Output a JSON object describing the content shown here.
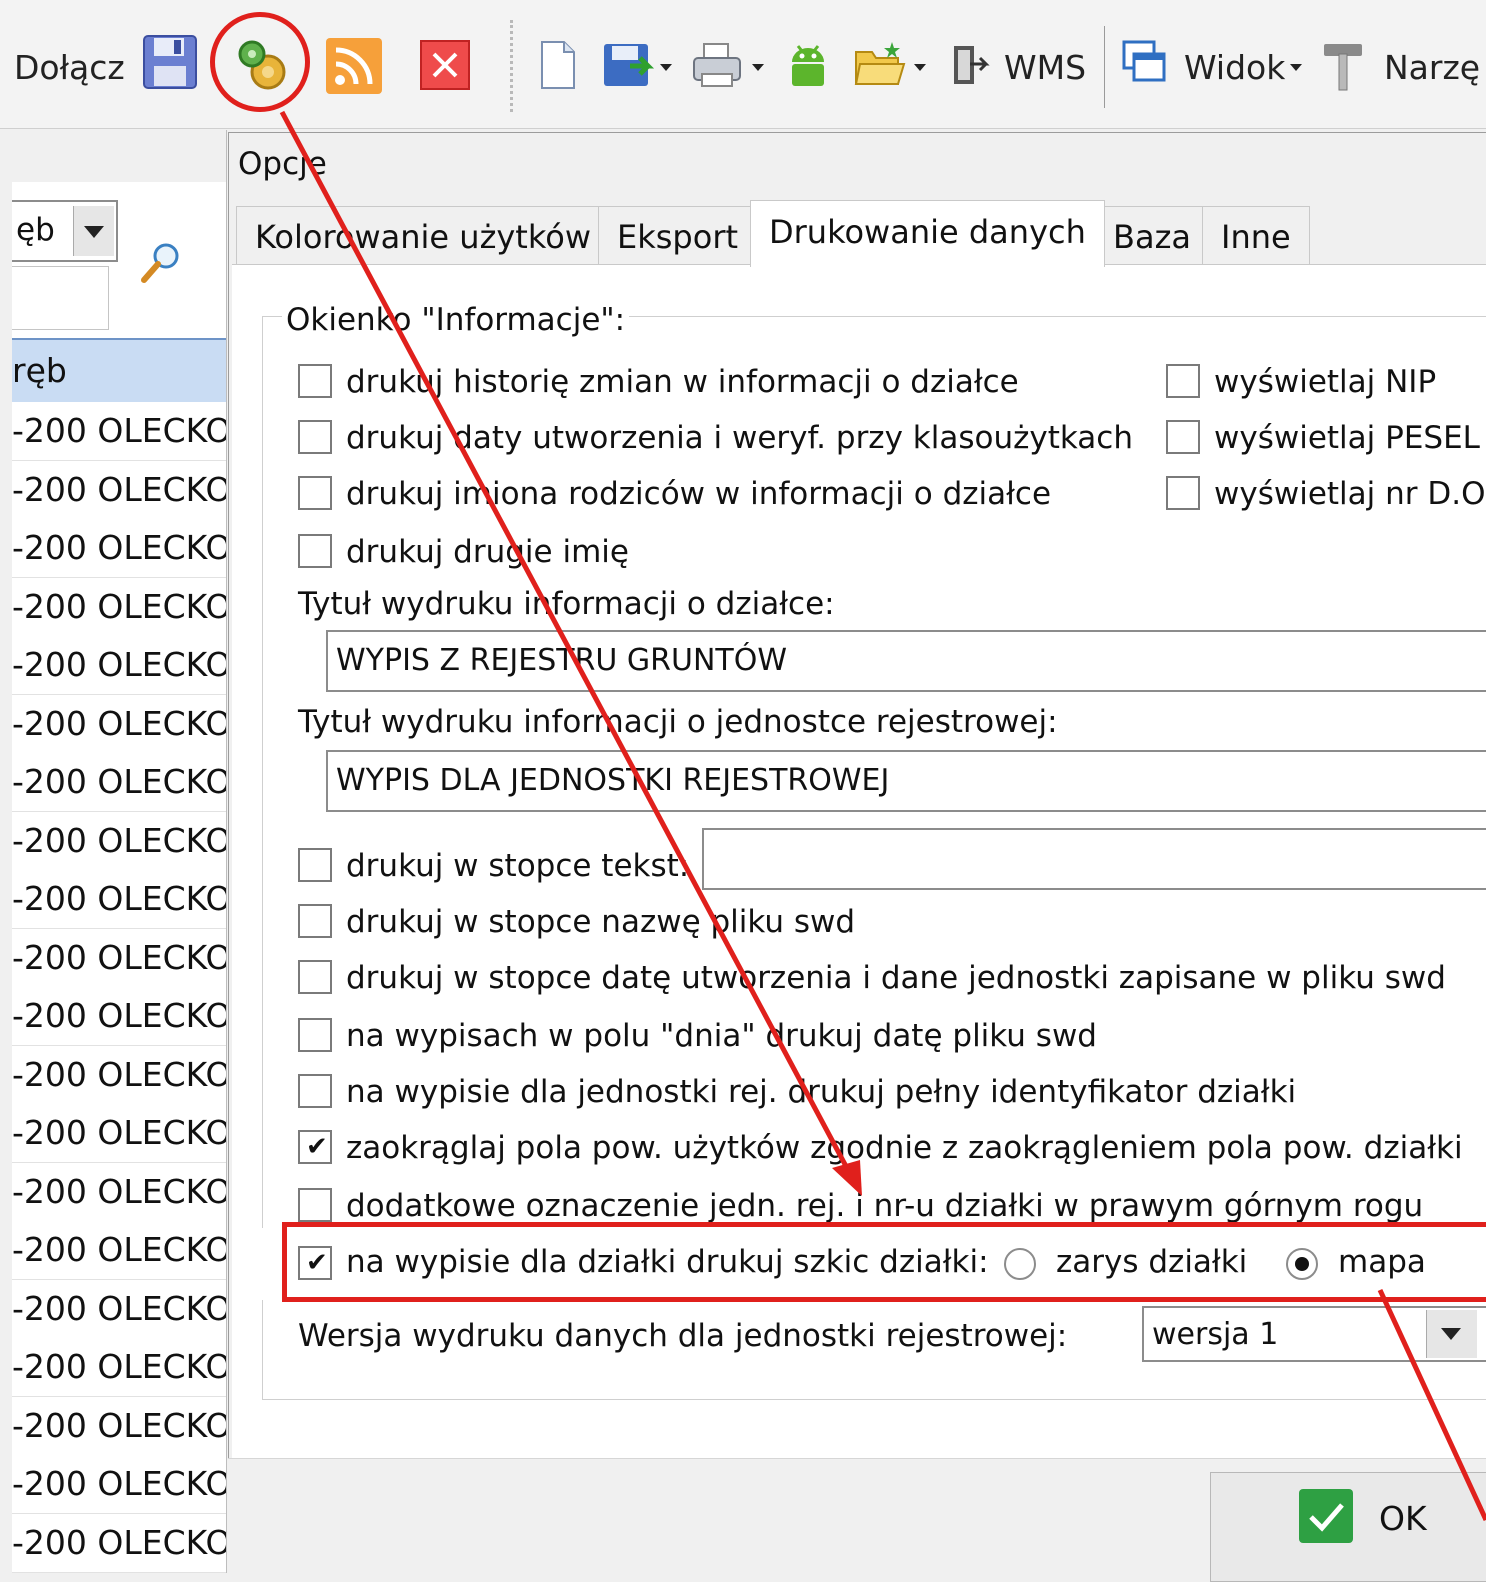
{
  "toolbar": {
    "join_label": "Dołącz",
    "wms_label": "WMS",
    "view_label": "Widok",
    "tools_label": "Narzę"
  },
  "left_panel": {
    "combo_value": "ęb",
    "column_header": "ręb",
    "rows": [
      "-200 OLECKO",
      "-200 OLECKO",
      "-200 OLECKO",
      "-200 OLECKO",
      "-200 OLECKO",
      "-200 OLECKO",
      "-200 OLECKO",
      "-200 OLECKO",
      "-200 OLECKO",
      "-200 OLECKO",
      "-200 OLECKO",
      "-200 OLECKO",
      "-200 OLECKO",
      "-200 OLECKO",
      "-200 OLECKO",
      "-200 OLECKO",
      "-200 OLECKO",
      "-200 OLECKO",
      "-200 OLECKO",
      "-200 OLECKO"
    ]
  },
  "dialog": {
    "title": "Opcje",
    "tabs": [
      {
        "label": "Kolorowanie użytków",
        "active": false
      },
      {
        "label": "Eksport",
        "active": false
      },
      {
        "label": "Drukowanie danych",
        "active": true
      },
      {
        "label": "Baza",
        "active": false
      },
      {
        "label": "Inne",
        "active": false
      }
    ],
    "group_title": "Okienko \"Informacje\":",
    "options_left": [
      {
        "label": "drukuj historię zmian w informacji o działce",
        "checked": false
      },
      {
        "label": "drukuj daty utworzenia i weryf. przy klasoużytkach",
        "checked": false
      },
      {
        "label": "drukuj imiona rodziców w informacji o działce",
        "checked": false
      },
      {
        "label": "drukuj drugie imię",
        "checked": false
      }
    ],
    "options_right": [
      {
        "label": "wyświetlaj NIP",
        "checked": false
      },
      {
        "label": "wyświetlaj PESEL",
        "checked": false
      },
      {
        "label": "wyświetlaj nr D.O",
        "checked": false
      }
    ],
    "title_parcel_label": "Tytuł wydruku informacji o działce:",
    "title_parcel_value": "WYPIS Z REJESTRU GRUNTÓW",
    "title_unit_label": "Tytuł wydruku informacji o jednostce rejestrowej:",
    "title_unit_value": "WYPIS DLA JEDNOSTKI REJESTROWEJ",
    "footer_text_label": "drukuj w stopce tekst:",
    "footer_text_value": "",
    "options_lower": [
      {
        "label": "drukuj w stopce nazwę pliku swd",
        "checked": false
      },
      {
        "label": "drukuj w stopce datę utworzenia i dane jednostki zapisane w pliku swd",
        "checked": false
      },
      {
        "label": "na wypisach w polu \"dnia\" drukuj datę pliku swd",
        "checked": false
      },
      {
        "label": "na wypisie dla jednostki rej. drukuj pełny identyfikator działki",
        "checked": false
      },
      {
        "label": "zaokrąglaj pola pow. użytków zgodnie z zaokrągleniem pola pow. działki",
        "checked": true
      },
      {
        "label": "dodatkowe oznaczenie jedn. rej. i nr-u działki w prawym górnym rogu",
        "checked": false
      }
    ],
    "sketch_option": {
      "label": "na wypisie dla działki drukuj szkic działki:",
      "checked": true
    },
    "sketch_radio": [
      {
        "label": "zarys działki",
        "selected": false
      },
      {
        "label": "mapa",
        "selected": true
      }
    ],
    "version_label": "Wersja wydruku danych dla jednostki rejestrowej:",
    "version_value": "wersja 1",
    "ok_label": "OK"
  },
  "colors": {
    "annotation_red": "#e0201c",
    "header_blue": "#c9dcf3",
    "ok_green": "#2ea043"
  }
}
